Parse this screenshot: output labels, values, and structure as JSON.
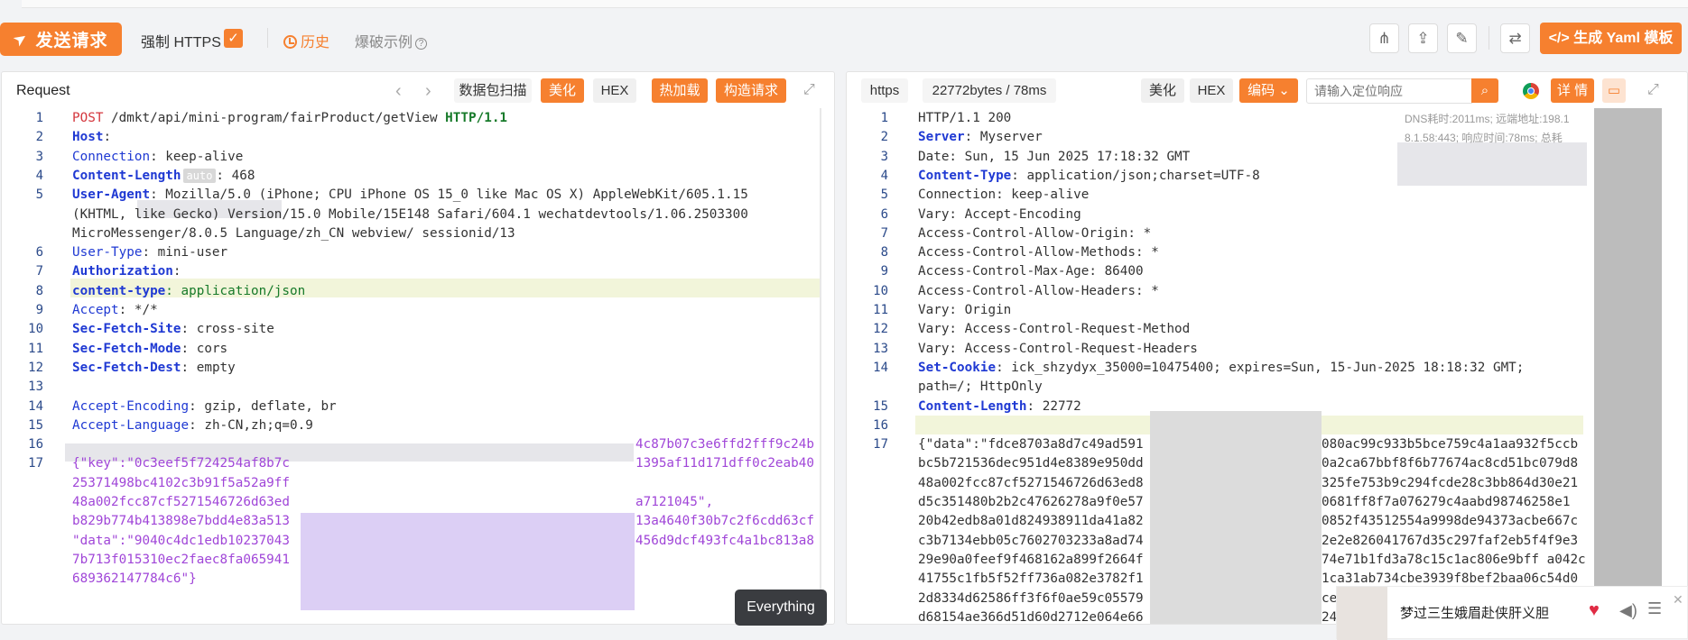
{
  "toolbar": {
    "send_label": "发送请求",
    "force_https_label": "强制 HTTPS",
    "force_https_checked": true,
    "history_label": "历史",
    "blast_label": "爆破示例",
    "generate_yaml_label": "生成 Yaml 模板",
    "icons": [
      "share-icon",
      "export-icon",
      "edit-icon",
      "swap-icon",
      "code-icon"
    ]
  },
  "request": {
    "title": "Request",
    "buttons": {
      "scan": "数据包扫描",
      "beautify": "美化",
      "hex": "HEX",
      "hot_reload": "热加载",
      "build": "构造请求"
    },
    "lines": [
      {
        "n": "1",
        "method": "POST",
        "path": " /dmkt/api/mini-program/fairProduct/getView ",
        "proto": "HTTP/1.1"
      },
      {
        "n": "2",
        "key": "Host",
        "rest": ":"
      },
      {
        "n": "3",
        "key": "Connection",
        "rest": ": keep-alive"
      },
      {
        "n": "4",
        "key": "Content-Length",
        "badge": "auto",
        "rest": ": 468"
      },
      {
        "n": "5",
        "key": "User-Agent",
        "rest": ": Mozilla/5.0 (iPhone; CPU iPhone OS 15_0 like Mac OS X) AppleWebKit/605.1.15"
      },
      {
        "n": "",
        "rest": "(KHTML, like Gecko) Version/15.0 Mobile/15E148 Safari/604.1 wechatdevtools/1.06.2503300"
      },
      {
        "n": "",
        "rest": "MicroMessenger/8.0.5 Language/zh_CN webview/ sessionid/13"
      },
      {
        "n": "6",
        "key": "User-Type",
        "rest": ": mini-user"
      },
      {
        "n": "7",
        "key": "Authorization",
        "rest": ":"
      },
      {
        "n": "8",
        "key": "content-type",
        "rest": ": application/json"
      },
      {
        "n": "9",
        "key": "Accept",
        "rest": ": */*"
      },
      {
        "n": "10",
        "key": "Sec-Fetch-Site",
        "rest": ": cross-site"
      },
      {
        "n": "11",
        "key": "Sec-Fetch-Mode",
        "rest": ": cors"
      },
      {
        "n": "12",
        "key": "Sec-Fetch-Dest",
        "rest": ": empty"
      },
      {
        "n": "13",
        "rest": ""
      },
      {
        "n": "14",
        "key": "Accept-Encoding",
        "rest": ": gzip, deflate, br"
      },
      {
        "n": "15",
        "key": "Accept-Language",
        "rest": ": zh-CN,zh;q=0.9"
      },
      {
        "n": "16",
        "rest": ""
      },
      {
        "n": "17",
        "body": "{\"key\":\"0c3eef5f724254af8b7c"
      },
      {
        "n": "",
        "body": "25371498bc4102c3b91f5a52a9ff"
      },
      {
        "n": "",
        "body": "48a002fcc87cf5271546726d63ed"
      },
      {
        "n": "",
        "body": "b829b774b413898e7bdd4e83a513"
      },
      {
        "n": "",
        "body": "\"data\":\"9040c4dc1edb10237043"
      },
      {
        "n": "",
        "body": "7b713f015310ec2faec8fa065941"
      },
      {
        "n": "",
        "body": "689362147784c6\"}"
      }
    ],
    "body_right": [
      "4c87b07c3e6ffd2fff9c24b",
      "1395af11d171dff0c2eab40",
      "a7121045\",",
      "13a4640f30b7c2f6cdd63cf",
      "456d9dcf493fc4a1bc813a8"
    ]
  },
  "response": {
    "scheme": "https",
    "size_time": "22772bytes / 78ms",
    "buttons": {
      "beautify": "美化",
      "hex": "HEX",
      "encoding": "编码",
      "detail": "详 情"
    },
    "search_placeholder": "请输入定位响应",
    "meta": [
      "DNS耗时:2011ms; 远端地址:198.1",
      "8.1.58:443; 响应时间:78ms; 总耗"
    ],
    "lines": [
      {
        "n": "1",
        "plain": "HTTP/1.1 200"
      },
      {
        "n": "2",
        "key": "Server",
        "rest": ": Myserver"
      },
      {
        "n": "3",
        "plain": "Date: Sun, 15 Jun 2025 17:18:32 GMT"
      },
      {
        "n": "4",
        "key": "Content-Type",
        "rest": ": application/json;charset=UTF-8"
      },
      {
        "n": "5",
        "plain": "Connection: keep-alive"
      },
      {
        "n": "6",
        "plain": "Vary: Accept-Encoding"
      },
      {
        "n": "7",
        "plain": "Access-Control-Allow-Origin: *"
      },
      {
        "n": "8",
        "plain": "Access-Control-Allow-Methods: *"
      },
      {
        "n": "9",
        "plain": "Access-Control-Max-Age: 86400"
      },
      {
        "n": "10",
        "plain": "Access-Control-Allow-Headers: *"
      },
      {
        "n": "11",
        "plain": "Vary: Origin"
      },
      {
        "n": "12",
        "plain": "Vary: Access-Control-Request-Method"
      },
      {
        "n": "13",
        "plain": "Vary: Access-Control-Request-Headers"
      },
      {
        "n": "14",
        "key": "Set-Cookie",
        "rest": ": ick_shzydyx_35000=10475400; expires=Sun, 15-Jun-2025 18:18:32 GMT;"
      },
      {
        "n": "",
        "plain": "path=/; HttpOnly"
      },
      {
        "n": "15",
        "key": "Content-Length",
        "rest": ": 22772"
      },
      {
        "n": "16",
        "plain": ""
      },
      {
        "n": "17",
        "plain": "{\"data\":\"fdce8703a8d7c49ad591"
      },
      {
        "n": "",
        "plain": "bc5b721536dec951d4e8389e950dd"
      },
      {
        "n": "",
        "plain": "48a002fcc87cf5271546726d63ed8"
      },
      {
        "n": "",
        "plain": "d5c351480b2b2c47626278a9f0e57"
      },
      {
        "n": "",
        "plain": "20b42edb8a01d824938911da41a82"
      },
      {
        "n": "",
        "plain": "c3b7134ebb05c7602703233a8ad74"
      },
      {
        "n": "",
        "plain": "29e90a0feef9f468162a899f2664f"
      },
      {
        "n": "",
        "plain": "41755c1fb5f52ff736a082e3782f1"
      },
      {
        "n": "",
        "plain": "2d8334d62586ff3f6f0ae59c05579"
      },
      {
        "n": "",
        "plain": "d68154ae366d51d60d2712e064e66"
      }
    ],
    "body_right": [
      "080ac99c933b5bce759c4a1aa932f5ccb",
      "0a2ca67bbf8f6b77674ac8cd51bc079d8",
      "325fe753b9c294fcde28c3bb864d30e21",
      "0681ff8f7a076279c4aabd98746258e1",
      "0852f43512554a9998de94373acbe667c",
      "2e2e826041767d35c297faf2eb5f4f9e3",
      "74e71b1fd3a78c15c1ac806e9bff a042c",
      "1ca31ab734cbe3939f8bef2baa06c54d0",
      "ce",
      "24"
    ]
  },
  "tooltip": "Everything",
  "music": {
    "title": "梦过三生娥眉赴侠肝义胆"
  }
}
